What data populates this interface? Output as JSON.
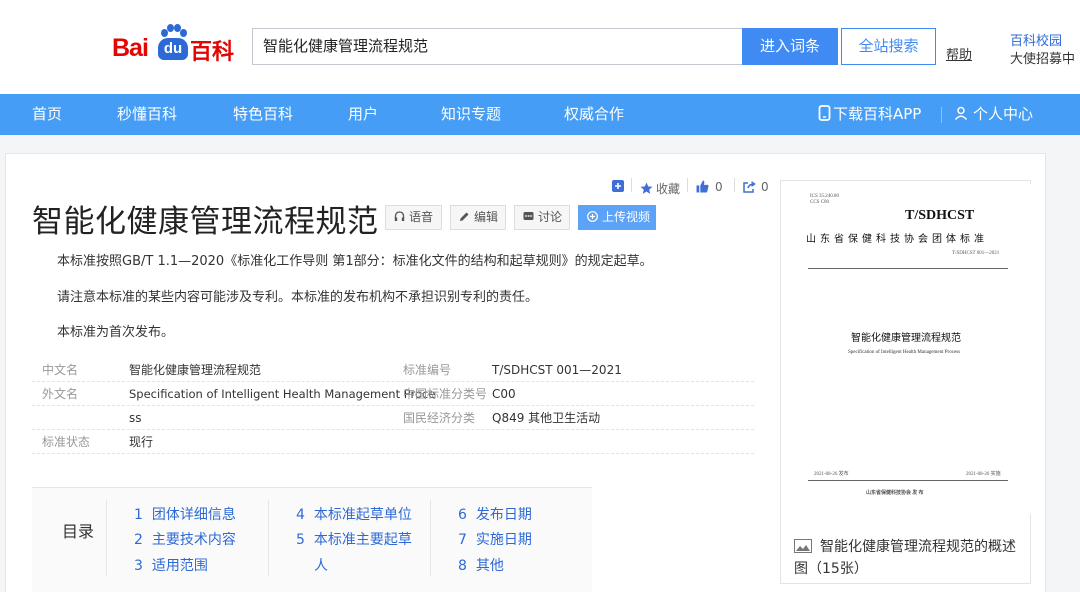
{
  "header": {
    "logo_bai": "Bai",
    "logo_du": "du",
    "logo_baike": "百科",
    "search_value": "智能化健康管理流程规范",
    "enter_button": "进入词条",
    "site_search_button": "全站搜索",
    "help_link": "帮助",
    "campus_link": "百科校园",
    "campus_sub": "大使招募中"
  },
  "nav": {
    "items": [
      "首页",
      "秒懂百科",
      "特色百科",
      "用户",
      "知识专题",
      "权威合作"
    ],
    "download_app": "下载百科APP",
    "personal_center": "个人中心"
  },
  "toolbar": {
    "collect_label": "收藏",
    "like_count": "0",
    "share_count": "0"
  },
  "article": {
    "title": "智能化健康管理流程规范",
    "buttons": {
      "voice": "语音",
      "edit": "编辑",
      "discuss": "讨论",
      "upload_video": "上传视频"
    },
    "paragraphs": [
      "本标准按照GB/T 1.1—2020《标准化工作导则 第1部分：标准化文件的结构和起草规则》的规定起草。",
      "请注意本标准的某些内容可能涉及专利。本标准的发布机构不承担识别专利的责任。",
      "本标准为首次发布。"
    ]
  },
  "info_box": {
    "rows": [
      {
        "label_left": "中文名",
        "value_left": "智能化健康管理流程规范",
        "label_right": "标准编号",
        "value_right": "T/SDHCST 001—2021"
      },
      {
        "label_left": "外文名",
        "value_left": "Specification of Intelligent Health Management Proce",
        "label_right": "中国标准分类号",
        "value_right": "C00"
      },
      {
        "label_left": "",
        "value_left": "ss",
        "label_right": "国民经济分类",
        "value_right": "Q849 其他卫生活动"
      },
      {
        "label_left": "标准状态",
        "value_left": "现行",
        "label_right": "",
        "value_right": ""
      }
    ]
  },
  "toc": {
    "title": "目录",
    "items": [
      {
        "num": "1",
        "label": "团体详细信息"
      },
      {
        "num": "2",
        "label": "主要技术内容"
      },
      {
        "num": "3",
        "label": "适用范围"
      },
      {
        "num": "4",
        "label": "本标准起草单位"
      },
      {
        "num": "5",
        "label": "本标准主要起草"
      },
      {
        "num": "",
        "label": "人"
      },
      {
        "num": "6",
        "label": "发布日期"
      },
      {
        "num": "7",
        "label": "实施日期"
      },
      {
        "num": "8",
        "label": "其他"
      }
    ]
  },
  "document_preview": {
    "ics_line": "ICS 35.240.80",
    "ccs_line": "CCS C00",
    "code": "T/SDHCST",
    "org": "山东省保健科技协会团体标准",
    "number": "T/SDHCST 001—2021",
    "title": "智能化健康管理流程规范",
    "english": "Specification of Intelligent Health Management Process",
    "publish_date": "2021-08-26 发布",
    "implement_date": "2021-08-26 实施",
    "publisher": "山东省保健科技协会    发 布",
    "caption": "智能化健康管理流程规范的概述图（15张）"
  },
  "colors": {
    "nav_blue": "#459df5",
    "link_blue": "#2d6ad6",
    "logo_red": "#e10602",
    "button_blue": "#3f8bf3"
  }
}
